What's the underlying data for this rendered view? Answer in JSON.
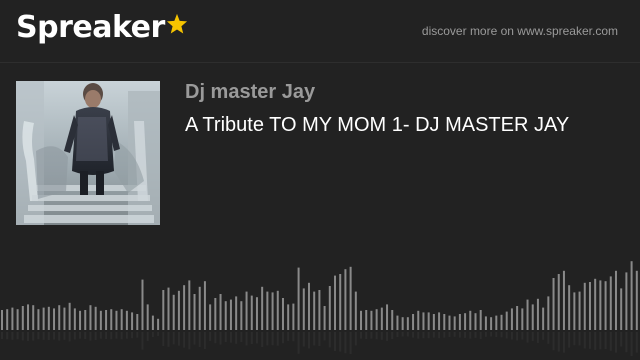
{
  "brand": {
    "name": "Spreaker",
    "star_color": "#f6c400"
  },
  "header": {
    "discover_text": "discover more on www.spreaker.com"
  },
  "episode": {
    "author": "Dj master Jay",
    "title": "A Tribute TO MY MOM 1- DJ MASTER JAY"
  },
  "cover": {
    "icon": "cover-photo"
  },
  "waveform": {
    "color": "#8a8a8a",
    "reflection_color": "#2c2c2c",
    "levels": [
      0.25,
      0.26,
      0.28,
      0.26,
      0.3,
      0.32,
      0.31,
      0.26,
      0.28,
      0.29,
      0.27,
      0.31,
      0.28,
      0.34,
      0.27,
      0.24,
      0.25,
      0.31,
      0.29,
      0.24,
      0.25,
      0.26,
      0.24,
      0.26,
      0.24,
      0.22,
      0.2,
      0.63,
      0.32,
      0.18,
      0.14,
      0.5,
      0.53,
      0.44,
      0.49,
      0.56,
      0.62,
      0.45,
      0.54,
      0.61,
      0.32,
      0.4,
      0.45,
      0.36,
      0.38,
      0.42,
      0.36,
      0.48,
      0.43,
      0.41,
      0.54,
      0.48,
      0.47,
      0.49,
      0.4,
      0.32,
      0.33,
      0.78,
      0.52,
      0.59,
      0.48,
      0.5,
      0.3,
      0.55,
      0.68,
      0.7,
      0.76,
      0.79,
      0.48,
      0.24,
      0.25,
      0.24,
      0.26,
      0.28,
      0.32,
      0.25,
      0.18,
      0.16,
      0.16,
      0.2,
      0.24,
      0.22,
      0.22,
      0.2,
      0.22,
      0.2,
      0.18,
      0.17,
      0.2,
      0.21,
      0.24,
      0.21,
      0.25,
      0.17,
      0.16,
      0.18,
      0.19,
      0.23,
      0.27,
      0.3,
      0.27,
      0.38,
      0.32,
      0.39,
      0.28,
      0.42,
      0.65,
      0.7,
      0.74,
      0.56,
      0.47,
      0.48,
      0.59,
      0.6,
      0.64,
      0.62,
      0.61,
      0.67,
      0.74,
      0.52,
      0.72,
      0.86,
      0.74
    ]
  }
}
